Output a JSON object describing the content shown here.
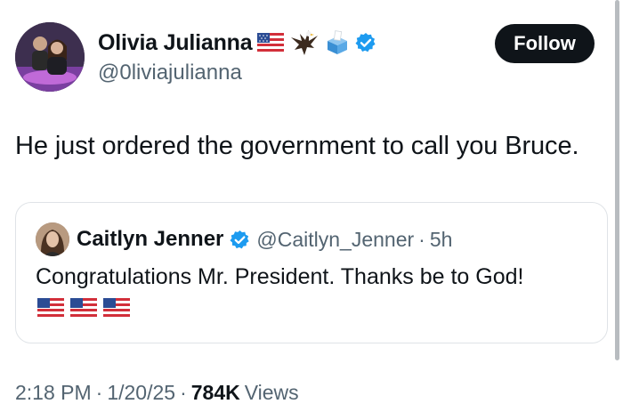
{
  "author": {
    "display_name": "Olivia Julianna",
    "handle": "@0liviajulianna",
    "name_emojis": [
      "us-flag-icon",
      "eagle-icon",
      "ballot-box-icon",
      "verified-badge-icon"
    ]
  },
  "follow_button": {
    "label": "Follow"
  },
  "tweet": {
    "text": "He just ordered the government to call you Bruce."
  },
  "quoted_tweet": {
    "display_name": "Caitlyn Jenner",
    "verified": true,
    "handle": "@Caitlyn_Jenner",
    "separator": "·",
    "time": "5h",
    "text": "Congratulations Mr. President. Thanks be to God!",
    "emojis": [
      "us-flag-icon",
      "us-flag-icon",
      "us-flag-icon"
    ]
  },
  "meta": {
    "time": "2:18 PM",
    "separator": "·",
    "date": "1/20/25",
    "separator2": "·",
    "views_count": "784K",
    "views_label": "Views"
  },
  "colors": {
    "text_primary": "#0f1419",
    "text_secondary": "#536471",
    "verified_blue": "#1d9bf0",
    "follow_bg": "#0f1419",
    "border": "#dfe3e7"
  }
}
